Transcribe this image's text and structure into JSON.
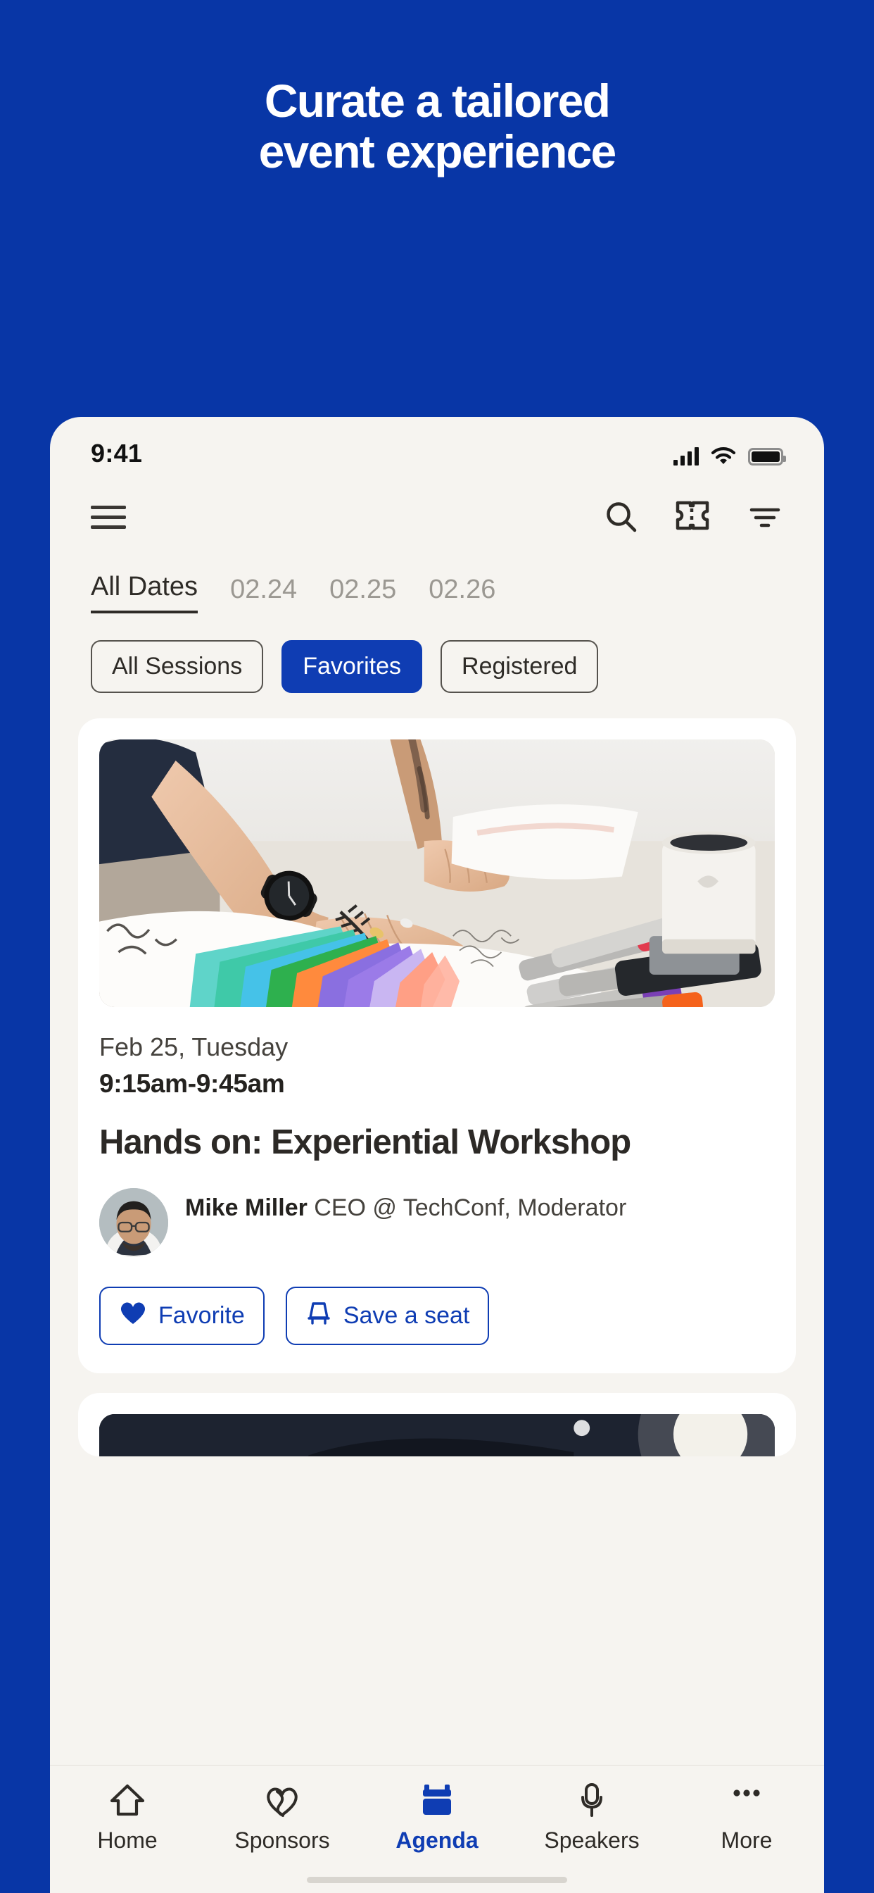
{
  "theme": {
    "brand_blue": "#0836a6",
    "accent_blue": "#0f3db3",
    "screen_bg": "#f6f4f0",
    "card_bg": "#ffffff",
    "text_dark": "#2c2926",
    "text_muted": "#9b9892"
  },
  "hero": {
    "line1": "Curate a tailored",
    "line2": "event experience"
  },
  "status_bar": {
    "time": "9:41",
    "signal_icon": "cellular-signal-icon",
    "wifi_icon": "wifi-icon",
    "battery_icon": "battery-full-icon"
  },
  "app_nav": {
    "menu_icon": "hamburger-menu-icon",
    "search_icon": "search-icon",
    "ticket_icon": "ticket-icon",
    "filter_icon": "filter-icon"
  },
  "date_tabs": [
    {
      "label": "All Dates",
      "active": true
    },
    {
      "label": "02.24",
      "active": false
    },
    {
      "label": "02.25",
      "active": false
    },
    {
      "label": "02.26",
      "active": false
    }
  ],
  "filter_chips": [
    {
      "label": "All Sessions",
      "selected": false
    },
    {
      "label": "Favorites",
      "selected": true
    },
    {
      "label": "Registered",
      "selected": false
    }
  ],
  "session_card": {
    "image_alt": "designer-hands-color-swatches-markers",
    "date": "Feb 25, Tuesday",
    "time": "9:15am-9:45am",
    "title": "Hands on: Experiential Workshop",
    "speaker": {
      "name": "Mike Miller",
      "role": "CEO @ TechConf,",
      "role_line2": "Moderator",
      "avatar_alt": "mike-miller-headshot"
    },
    "actions": [
      {
        "label": "Favorite",
        "icon": "heart-filled-icon"
      },
      {
        "label": "Save a seat",
        "icon": "seat-icon"
      }
    ]
  },
  "peek_card": {
    "image_alt": "dark-stage-photo"
  },
  "tab_bar": [
    {
      "label": "Home",
      "icon": "home-icon",
      "active": false
    },
    {
      "label": "Sponsors",
      "icon": "interlocking-hearts-icon",
      "active": false
    },
    {
      "label": "Agenda",
      "icon": "calendar-icon",
      "active": true
    },
    {
      "label": "Speakers",
      "icon": "microphone-icon",
      "active": false
    },
    {
      "label": "More",
      "icon": "ellipsis-icon",
      "active": false
    }
  ]
}
